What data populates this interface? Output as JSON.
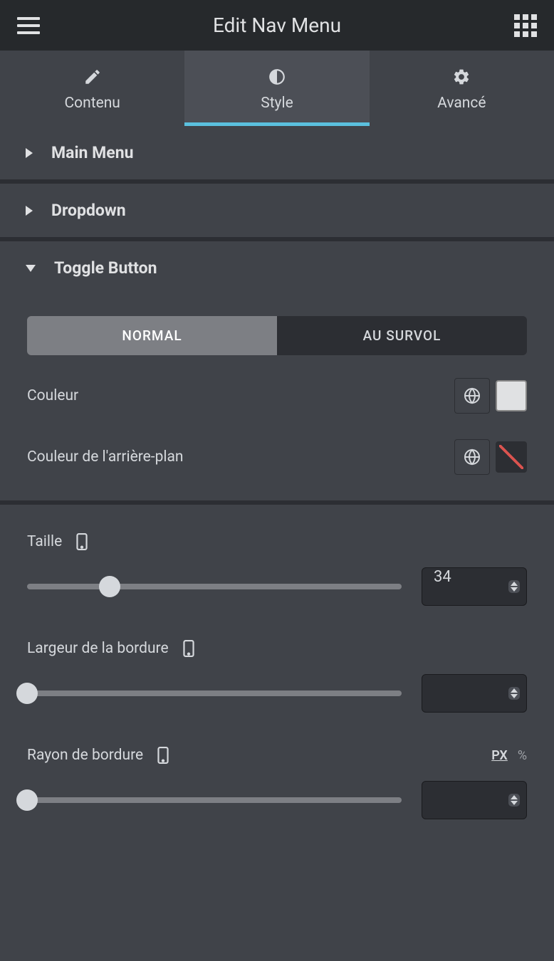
{
  "header": {
    "title": "Edit Nav Menu"
  },
  "tabs": [
    {
      "label": "Contenu",
      "icon": "pencil"
    },
    {
      "label": "Style",
      "icon": "contrast"
    },
    {
      "label": "Avancé",
      "icon": "gear"
    }
  ],
  "sections": [
    {
      "title": "Main Menu",
      "expanded": false
    },
    {
      "title": "Dropdown",
      "expanded": false
    },
    {
      "title": "Toggle Button",
      "expanded": true
    }
  ],
  "states": {
    "normal": "NORMAL",
    "hover": "AU SURVOL"
  },
  "color": {
    "label": "Couleur",
    "value": "#e0e1e3"
  },
  "bgcolor": {
    "label": "Couleur de l'arrière-plan",
    "value": null
  },
  "size": {
    "label": "Taille",
    "value": "34",
    "percent": 22
  },
  "border_width": {
    "label": "Largeur de la bordure",
    "value": "",
    "percent": 0
  },
  "border_radius": {
    "label": "Rayon de bordure",
    "value": "",
    "percent": 0,
    "units": {
      "px": "PX",
      "pct": "%"
    }
  }
}
